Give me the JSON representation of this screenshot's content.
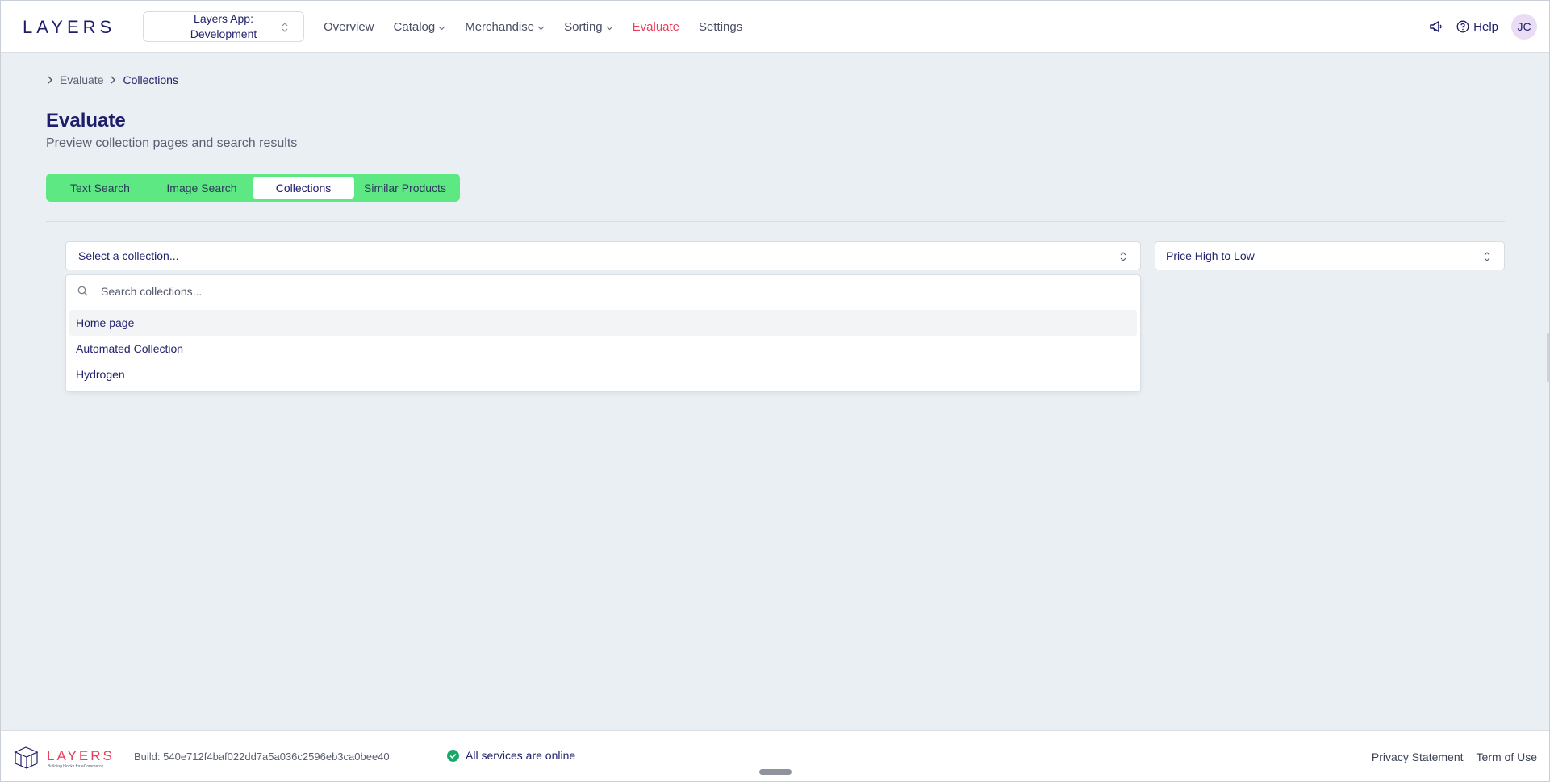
{
  "app": {
    "logo_text": "LAYERS",
    "switcher_label": "Layers App: Development"
  },
  "nav": {
    "items": [
      {
        "label": "Overview",
        "dropdown": false,
        "active": false
      },
      {
        "label": "Catalog",
        "dropdown": true,
        "active": false
      },
      {
        "label": "Merchandise",
        "dropdown": true,
        "active": false
      },
      {
        "label": "Sorting",
        "dropdown": true,
        "active": false
      },
      {
        "label": "Evaluate",
        "dropdown": false,
        "active": true
      },
      {
        "label": "Settings",
        "dropdown": false,
        "active": false
      }
    ],
    "help_label": "Help",
    "avatar_initials": "JC"
  },
  "breadcrumb": [
    "Evaluate",
    "Collections"
  ],
  "page": {
    "title": "Evaluate",
    "subtitle": "Preview collection pages and search results"
  },
  "tabs": [
    {
      "label": "Text Search",
      "selected": false
    },
    {
      "label": "Image Search",
      "selected": false
    },
    {
      "label": "Collections",
      "selected": true
    },
    {
      "label": "Similar Products",
      "selected": false
    }
  ],
  "collection_select": {
    "placeholder": "Select a collection...",
    "search_placeholder": "Search collections...",
    "options": [
      "Home page",
      "Automated Collection",
      "Hydrogen"
    ]
  },
  "sort_select": {
    "value": "Price High to Low"
  },
  "footer": {
    "logo_text": "LAYERS",
    "logo_tagline": "Building blocks for eCommerce",
    "build": "Build: 540e712f4baf022dd7a5a036c2596eb3ca0bee40",
    "status": "All services are online",
    "privacy": "Privacy Statement",
    "terms": "Term of Use"
  },
  "colors": {
    "accent": "#e8405d",
    "brand": "#1d1d6b",
    "tab_bar": "#5ee884",
    "status_ok": "#19a867"
  }
}
